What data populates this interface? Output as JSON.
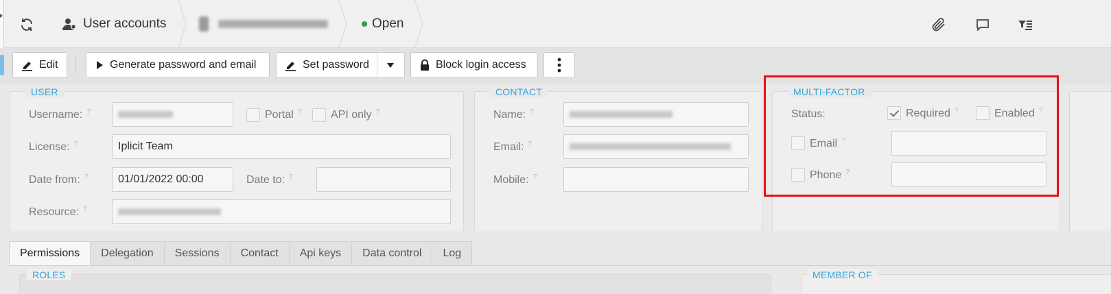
{
  "header": {
    "users_label": "User accounts",
    "status": "Open",
    "status_color": "#2aa147",
    "icons": [
      "refresh-icon",
      "user-accounts-icon",
      "paperclip-icon",
      "comment-icon",
      "filter-list-icon"
    ]
  },
  "toolbar": {
    "edit": "Edit",
    "generate": "Generate password and email",
    "set_password": "Set password",
    "block": "Block login access"
  },
  "user": {
    "legend": "USER",
    "username_label": "Username:",
    "portal_label": "Portal",
    "api_only_label": "API only",
    "license_label": "License:",
    "license_value": "Iplicit Team",
    "date_from_label": "Date from:",
    "date_from_value": "01/01/2022 00:00",
    "date_to_label": "Date to:",
    "resource_label": "Resource:"
  },
  "contact": {
    "legend": "CONTACT",
    "name_label": "Name:",
    "email_label": "Email:",
    "mobile_label": "Mobile:"
  },
  "mfa": {
    "legend": "MULTI-FACTOR",
    "status_label": "Status:",
    "required_label": "Required",
    "required_checked": true,
    "enabled_label": "Enabled",
    "enabled_checked": false,
    "email_label": "Email",
    "phone_label": "Phone"
  },
  "tabs": [
    "Permissions",
    "Delegation",
    "Sessions",
    "Contact",
    "Api keys",
    "Data control",
    "Log"
  ],
  "active_tab": "Permissions",
  "sections": {
    "roles": "ROLES",
    "member_of": "MEMBER OF"
  },
  "accent_color": "#35a4dc",
  "highlight_color": "#e81010"
}
